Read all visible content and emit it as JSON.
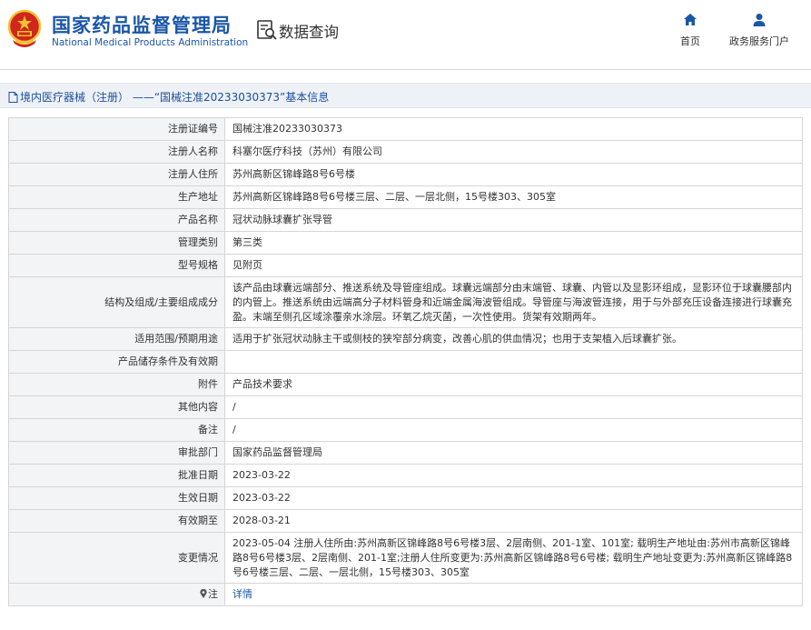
{
  "header": {
    "org_name_cn": "国家药品监督管理局",
    "org_name_en": "National Medical Products Administration",
    "section_title": "数据查询",
    "nav": [
      {
        "label": "首页",
        "icon": "home-icon"
      },
      {
        "label": "政务服务门户",
        "icon": "user-icon"
      }
    ]
  },
  "breadcrumb": {
    "text": "境内医疗器械（注册） ——“国械注准20233030373”基本信息",
    "icon": "document-icon"
  },
  "table": [
    {
      "label": "注册证编号",
      "value": "国械注准20233030373"
    },
    {
      "label": "注册人名称",
      "value": "科塞尔医疗科技（苏州）有限公司"
    },
    {
      "label": "注册人住所",
      "value": "苏州高新区锦峰路8号6号楼"
    },
    {
      "label": "生产地址",
      "value": "苏州高新区锦峰路8号6号楼三层、二层、一层北侧，15号楼303、305室"
    },
    {
      "label": "产品名称",
      "value": "冠状动脉球囊扩张导管"
    },
    {
      "label": "管理类别",
      "value": "第三类"
    },
    {
      "label": "型号规格",
      "value": "见附页"
    },
    {
      "label": "结构及组成/主要组成成分",
      "value": "该产品由球囊远端部分、推送系统及导管座组成。球囊远端部分由末端管、球囊、内管以及显影环组成，显影环位于球囊腰部内的内管上。推送系统由远端高分子材料管身和近端金属海波管组成。导管座与海波管连接，用于与外部充压设备连接进行球囊充盈。末端至侧孔区域涂覆亲水涂层。环氧乙烷灭菌，一次性使用。货架有效期两年。"
    },
    {
      "label": "适用范围/预期用途",
      "value": "适用于扩张冠状动脉主干或侧枝的狭窄部分病变，改善心肌的供血情况；也用于支架植入后球囊扩张。"
    },
    {
      "label": "产品储存条件及有效期",
      "value": ""
    },
    {
      "label": "附件",
      "value": "产品技术要求"
    },
    {
      "label": "其他内容",
      "value": "/"
    },
    {
      "label": "备注",
      "value": "/"
    },
    {
      "label": "审批部门",
      "value": "国家药品监督管理局"
    },
    {
      "label": "批准日期",
      "value": "2023-03-22"
    },
    {
      "label": "生效日期",
      "value": "2023-03-22"
    },
    {
      "label": "有效期至",
      "value": "2028-03-21"
    },
    {
      "label": "变更情况",
      "value": "2023-05-04 注册人住所由:苏州高新区锦峰路8号6号楼3层、2层南侧、201-1室、101室; 载明生产地址由:苏州市高新区锦峰路8号6号楼3层、2层南侧、201-1室;注册人住所变更为:苏州高新区锦峰路8号6号楼; 载明生产地址变更为:苏州高新区锦峰路8号6号楼三层、二层、一层北侧，15号楼303、305室"
    },
    {
      "label": "注",
      "value": "详情",
      "icon": "pin-icon"
    }
  ],
  "colors": {
    "brand_blue": "#1a56a8",
    "label_bg": "#f3f4f6",
    "crumb_bg": "#eef1f6",
    "emblem_red": "#d0261d",
    "emblem_gold": "#f2c230"
  }
}
